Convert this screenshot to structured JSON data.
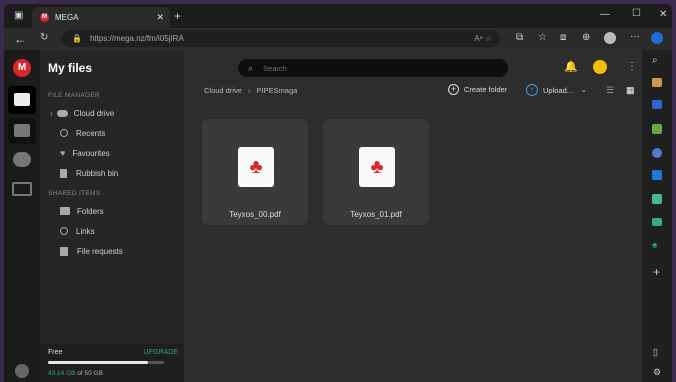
{
  "tab": {
    "title": "MEGA"
  },
  "address_bar": {
    "url": "https://mega.nz/fm/i05jIRA"
  },
  "sidebar": {
    "title": "My files",
    "file_manager_heading": "FILE MANAGER",
    "items": [
      {
        "label": "Cloud drive",
        "icon": "cloud-icon"
      },
      {
        "label": "Recents",
        "icon": "clock-icon"
      },
      {
        "label": "Favourites",
        "icon": "heart-icon"
      },
      {
        "label": "Rubbish bin",
        "icon": "trash-icon"
      }
    ],
    "shared_heading": "SHARED ITEMS",
    "shared_items": [
      {
        "label": "Folders",
        "icon": "shared-folder-icon"
      },
      {
        "label": "Links",
        "icon": "link-icon"
      },
      {
        "label": "File requests",
        "icon": "file-request-icon"
      }
    ],
    "storage": {
      "plan": "Free",
      "upgrade": "UPGRADE",
      "used": "43.14 GB",
      "of_text": "of 50 GB",
      "fraction": 0.863
    }
  },
  "search": {
    "placeholder": "Search"
  },
  "breadcrumb": {
    "root": "Cloud drive",
    "current": "PIPESmaga"
  },
  "toolbar": {
    "create_folder": "Create folder",
    "upload": "Upload..."
  },
  "files": [
    {
      "name": "Teyxos_00.pdf"
    },
    {
      "name": "Teyxos_01.pdf"
    }
  ],
  "colors": {
    "mega_red": "#d9272e",
    "accent_green": "#2ea86b",
    "bell_yellow": "#f2c200"
  }
}
